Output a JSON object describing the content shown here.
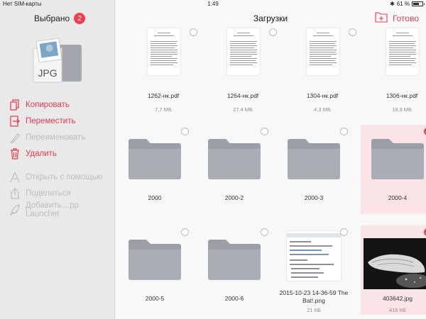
{
  "status_bar": {
    "carrier": "Нет SIM-карты",
    "time": "1:49",
    "battery": "61 %"
  },
  "sidebar": {
    "selected_label": "Выбрано",
    "selected_count": "2",
    "preview_label": "JPG",
    "actions": [
      {
        "label": "Копировать",
        "icon": "copy-icon",
        "enabled": true
      },
      {
        "label": "Переместить",
        "icon": "move-icon",
        "enabled": true
      },
      {
        "label": "Переименовать",
        "icon": "rename-icon",
        "enabled": false
      },
      {
        "label": "Удалить",
        "icon": "trash-icon",
        "enabled": true
      },
      {
        "label": "Открыть с помощью",
        "icon": "open-with-icon",
        "enabled": false
      },
      {
        "label": "Поделиться",
        "icon": "share-icon",
        "enabled": false
      },
      {
        "label": "Добавить…pp Launcher",
        "icon": "launcher-icon",
        "enabled": false
      }
    ]
  },
  "navbar": {
    "title": "Загрузки",
    "done_label": "Готово",
    "new_folder_icon": "new-folder-icon"
  },
  "files": [
    {
      "name": "1262-нк.pdf",
      "size": "7,7 МБ",
      "kind": "pdf",
      "selected": false
    },
    {
      "name": "1264-нк.pdf",
      "size": "27,4 МБ",
      "kind": "pdf",
      "selected": false
    },
    {
      "name": "1304-нк.pdf",
      "size": "4,3 МБ",
      "kind": "pdf",
      "selected": false
    },
    {
      "name": "1306-нк.pdf",
      "size": "18,3 МБ",
      "kind": "pdf",
      "selected": false
    },
    {
      "name": "2000",
      "size": "",
      "kind": "folder",
      "selected": false
    },
    {
      "name": "2000-2",
      "size": "",
      "kind": "folder",
      "selected": false
    },
    {
      "name": "2000-3",
      "size": "",
      "kind": "folder",
      "selected": false
    },
    {
      "name": "2000-4",
      "size": "",
      "kind": "folder",
      "selected": true
    },
    {
      "name": "2000-5",
      "size": "",
      "kind": "folder",
      "selected": false
    },
    {
      "name": "2000-6",
      "size": "",
      "kind": "folder",
      "selected": false
    },
    {
      "name": "2015-10-23 14-36-59 The Bat!.png",
      "size": "21 КБ",
      "kind": "png",
      "selected": false
    },
    {
      "name": "403642.jpg",
      "size": "416 КБ",
      "kind": "jpg",
      "selected": true
    }
  ],
  "colors": {
    "accent": "#f13b50",
    "disabled": "#bdbdbf",
    "selected_bg": "#fbe4e6",
    "folder": "#9a9ea6"
  }
}
